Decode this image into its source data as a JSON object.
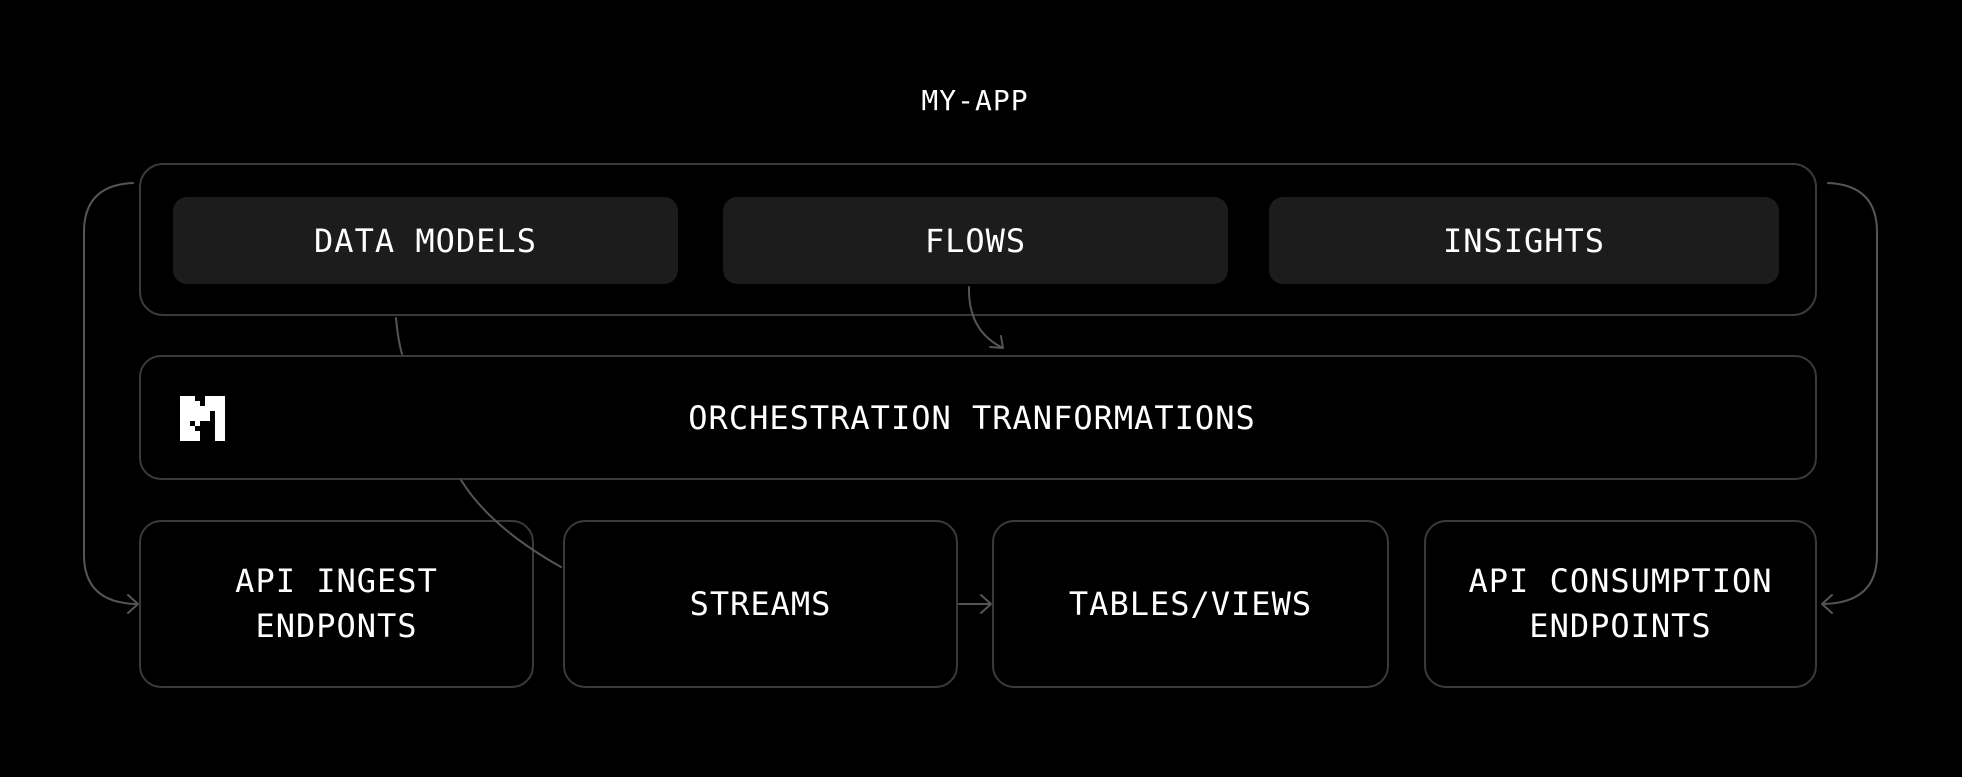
{
  "title": "MY-APP",
  "top_row": {
    "items": [
      {
        "label": "DATA MODELS"
      },
      {
        "label": "FLOWS"
      },
      {
        "label": "INSIGHTS"
      }
    ]
  },
  "orchestration": {
    "label": "ORCHESTRATION TRANFORMATIONS",
    "logo_icon": "m-block-logo"
  },
  "bottom_row": {
    "items": [
      {
        "line1": "API INGEST",
        "line2": "ENDPONTS"
      },
      {
        "line1": "STREAMS"
      },
      {
        "line1": "TABLES/VIEWS"
      },
      {
        "line1": "API CONSUMPTION",
        "line2": "ENDPOINTS"
      }
    ]
  },
  "colors": {
    "background": "#000000",
    "border": "#3a3a3a",
    "pill": "#1c1c1c",
    "text": "#ffffff"
  }
}
